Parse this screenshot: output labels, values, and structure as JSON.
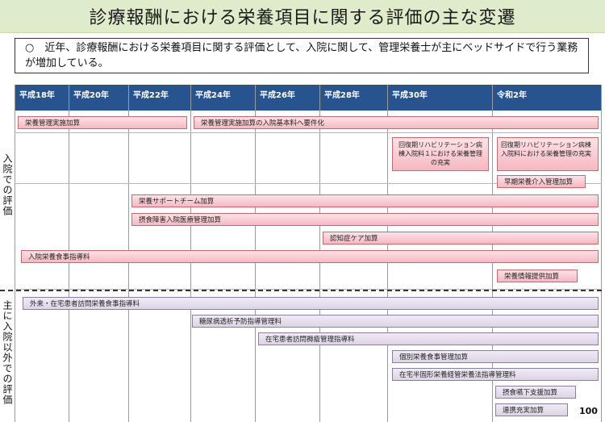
{
  "title": "診療報酬における栄養項目に関する評価の主な変遷",
  "summary": "○　近年、診療報酬における栄養項目に関する評価として、入院に関して、管理栄養士が主にベッドサイドで行う業務が増加している。",
  "years": [
    "平成18年",
    "平成20年",
    "平成22年",
    "平成24年",
    "平成26年",
    "平成28年",
    "平成30年",
    "令和2年"
  ],
  "sections": {
    "inpatient": "入院での評価",
    "outpatient": "主に入院以外での評価"
  },
  "inpatient_items": {
    "eiyo_kanri_jisshi": "栄養管理実施加算",
    "eiyo_kanri_kihon": "栄養管理実施加算の入院基本料へ要件化",
    "kaifuku_h30": "回復期リハビリテーション病棟入院料１における栄養管理の充実",
    "kaifuku_r2": "回復期リハビリテーション病棟入院料における栄養管理の充実",
    "soki_eiyo": "早期栄養介入管理加算",
    "nst": "栄養サポートチーム加算",
    "sesshoku": "摂食障害入院医療管理加算",
    "ninchisho": "認知症ケア加算",
    "nyuin_shidou": "入院栄養食事指導料",
    "joho_teikyo": "栄養情報提供加算"
  },
  "outpatient_items": {
    "gairai": "外来・在宅患者訪問栄養食事指導料",
    "tonyobyo": "糖尿病透析予防指導管理料",
    "jokuso": "在宅患者訪問褥瘡管理指導料",
    "kobetsu": "個別栄養食事管理加算",
    "zaitaku_hankotai": "在宅半固形栄養経管栄養法指導管理料",
    "engeshita": "摂食嚥下支援加算",
    "renkei": "連携充実加算"
  },
  "page_number": "100"
}
